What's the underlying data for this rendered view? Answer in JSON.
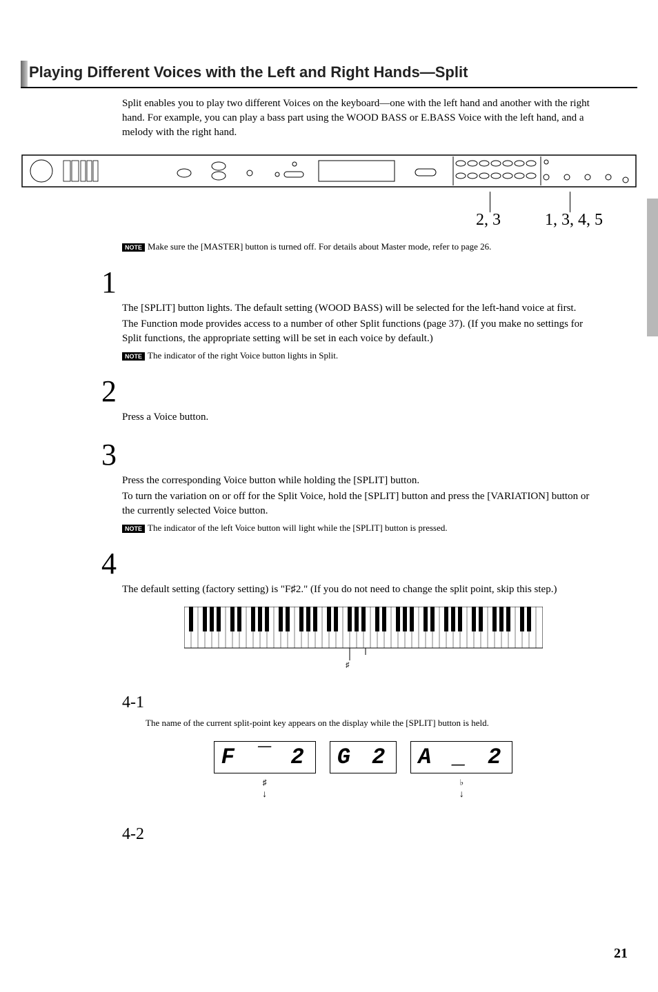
{
  "header": {
    "title": "Playing Different Voices with the Left and Right Hands—Split"
  },
  "intro": "Split enables you to play two different Voices on the keyboard—one with the left hand and another with the right hand. For example, you can play a bass part using the WOOD BASS or E.BASS Voice with the left hand, and a melody with the right hand.",
  "callouts": {
    "left": "2, 3",
    "right": "1, 3, 4, 5"
  },
  "note_top": "Make sure the [MASTER] button is turned off. For details about Master mode, refer to page 26.",
  "steps": {
    "s1": {
      "num": "1",
      "p1": "The [SPLIT] button lights. The default setting (WOOD BASS) will be selected for the left-hand voice at first.",
      "p2": "The Function mode provides access to a number of other Split functions (page 37). (If you make no settings for Split functions, the appropriate setting will be set in each voice by default.)",
      "note": "The indicator of the right Voice button lights in Split."
    },
    "s2": {
      "num": "2",
      "p1": "Press a Voice button."
    },
    "s3": {
      "num": "3",
      "p1": "Press the corresponding Voice button while holding the [SPLIT] button.",
      "p2": "To turn the variation on or off for the Split Voice, hold the [SPLIT] button and press the [VARIATION] button or the currently selected Voice button.",
      "note": "The indicator of the left Voice button will light while the [SPLIT] button is pressed."
    },
    "s4": {
      "num": "4",
      "p1": "The default setting (factory setting) is \"F♯2.\" (If you do not need to change the split point, skip this step.)"
    }
  },
  "substeps": {
    "ss41": {
      "num": "4-1",
      "text": "The name of the current split-point key appears on the display while the [SPLIT] button is held."
    },
    "ss42": {
      "num": "4-2"
    }
  },
  "displays": {
    "d1": {
      "seg": "F ‾ 2",
      "sub": "♯",
      "arrow": "↓"
    },
    "d2": {
      "seg": "G   2"
    },
    "d3": {
      "seg": "A _ 2",
      "sub": "♭",
      "arrow": "↓"
    }
  },
  "note_label": "NOTE",
  "page_number": "21"
}
